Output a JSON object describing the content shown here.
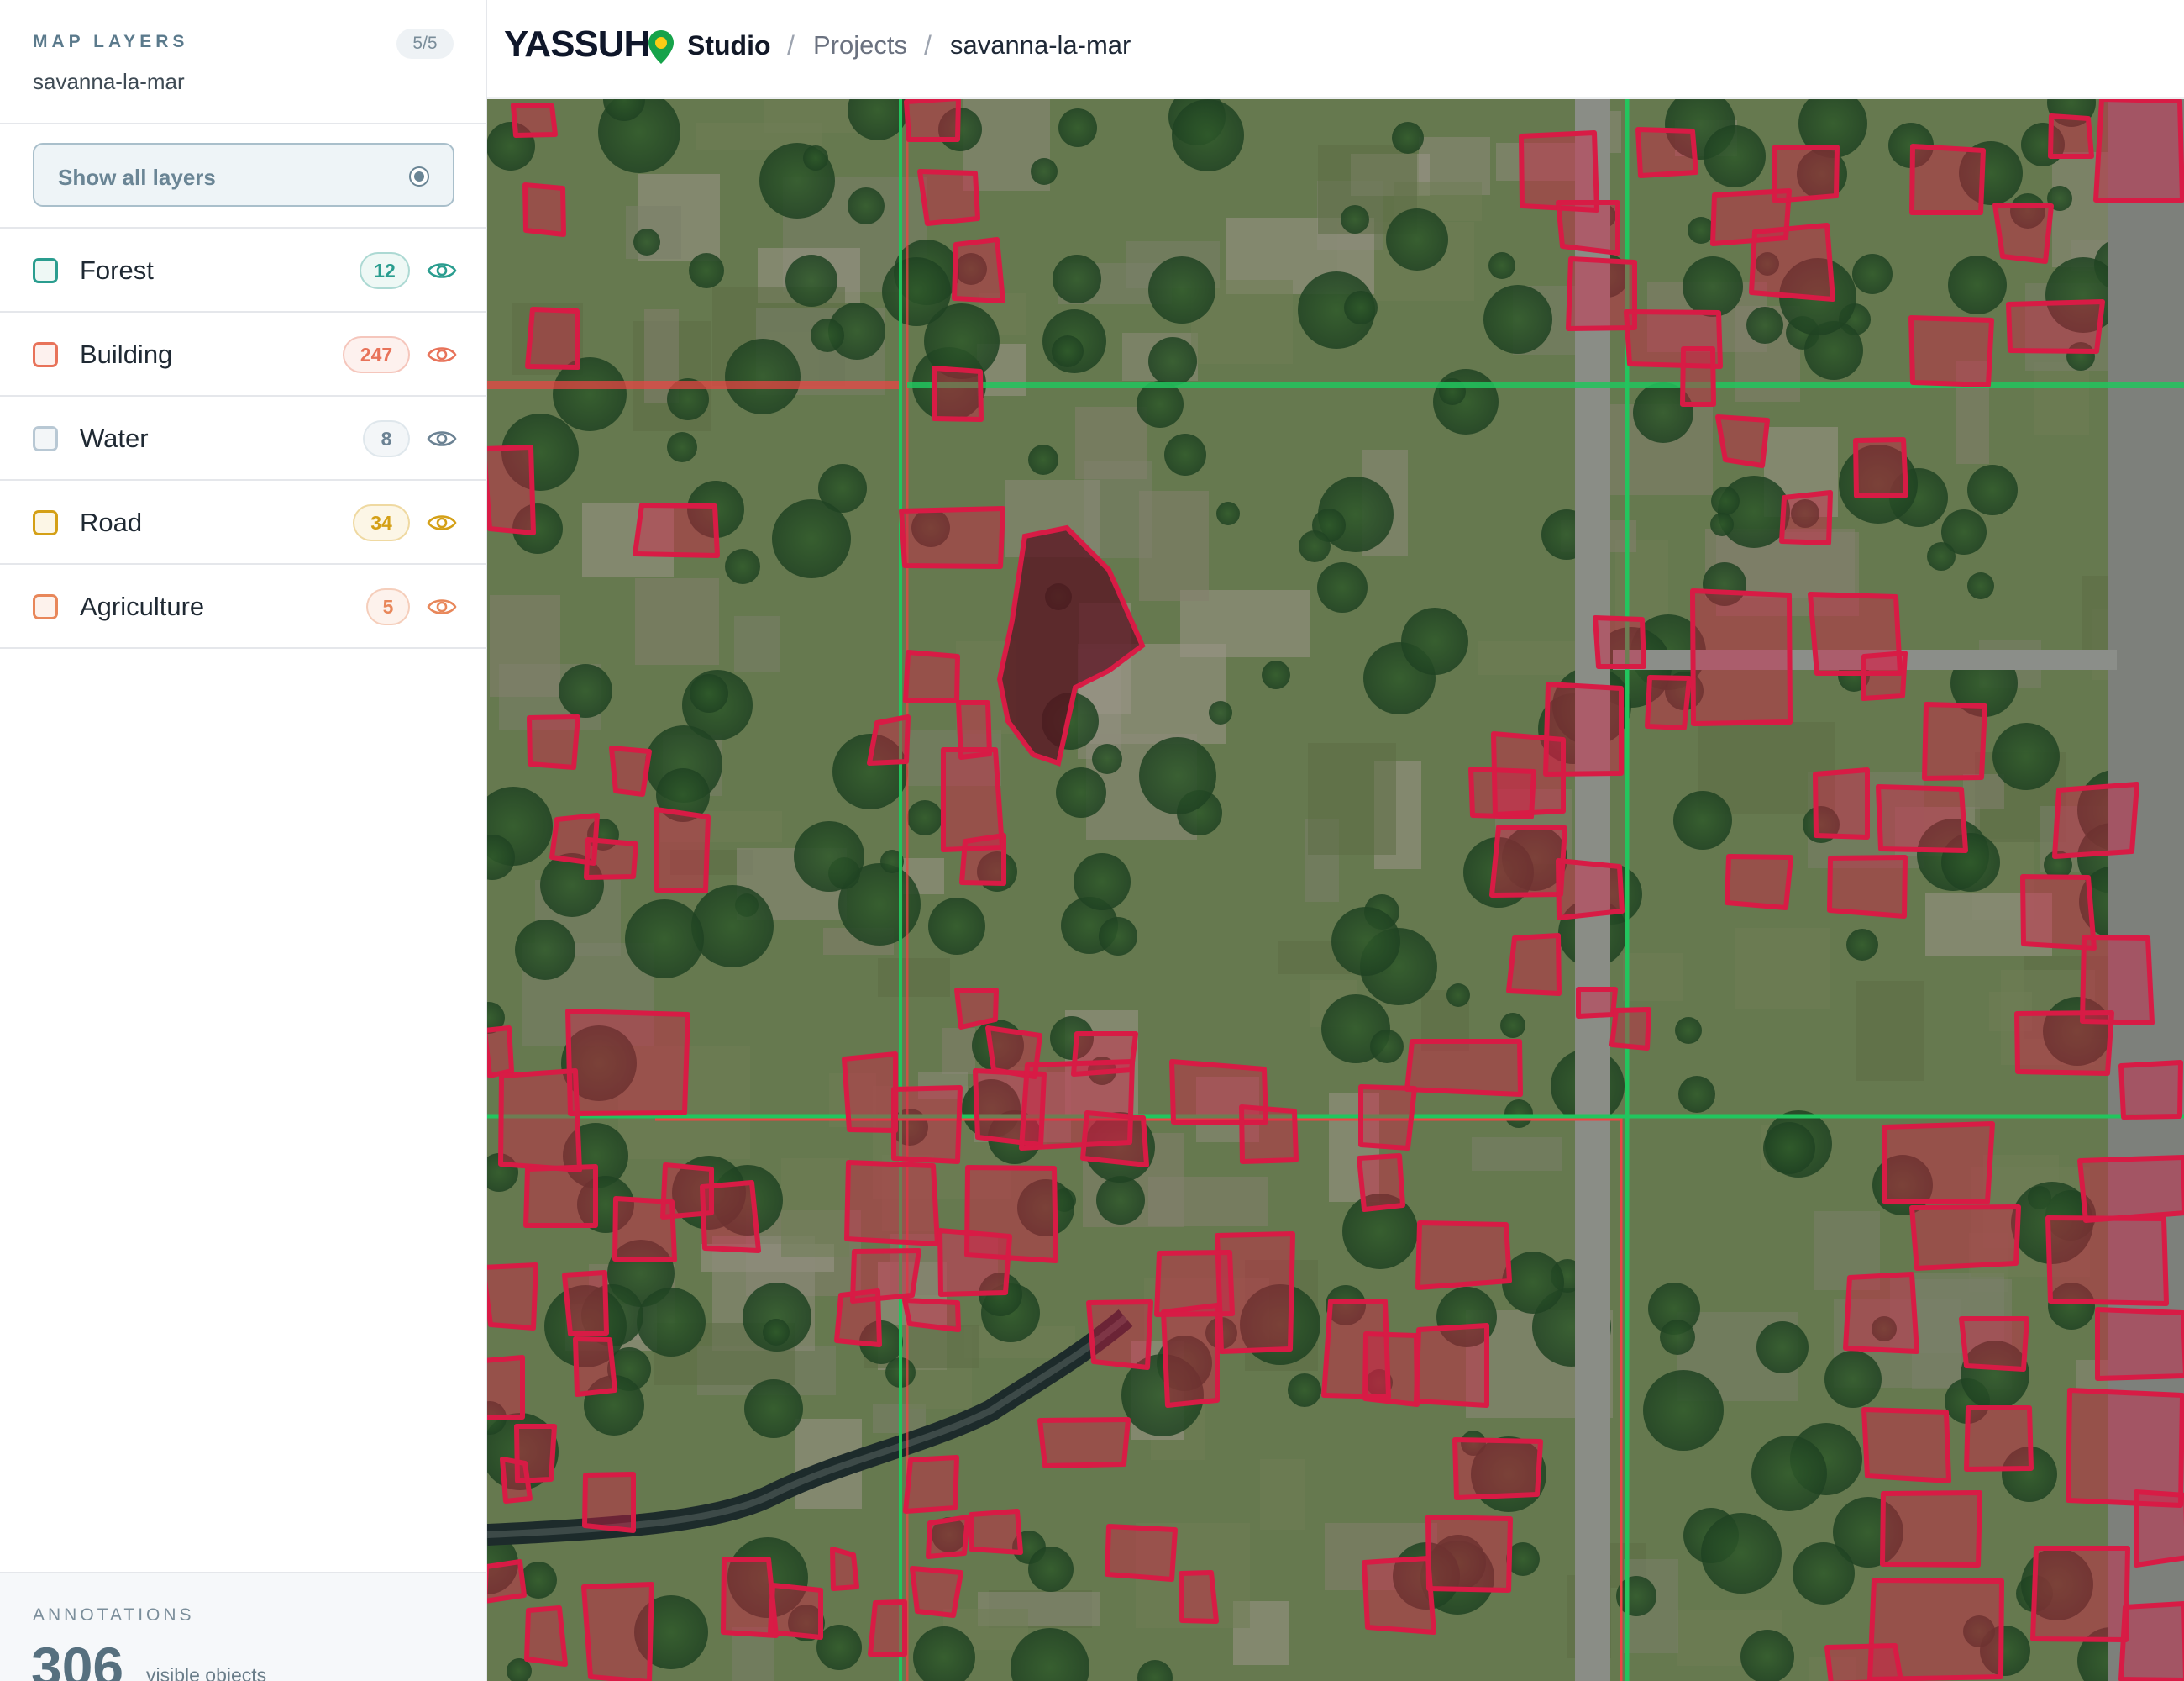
{
  "sidebar": {
    "title": "MAP LAYERS",
    "visible_count": "5/5",
    "project_name": "savanna-la-mar",
    "show_all_label": "Show all layers",
    "layers": [
      {
        "name": "Forest",
        "count": "12",
        "color": "#2a9d8f",
        "badge_bg": "#eef8f5",
        "visible": true,
        "icon": "eye-icon"
      },
      {
        "name": "Building",
        "count": "247",
        "color": "#e8735a",
        "badge_bg": "#fdf1ee",
        "visible": true,
        "icon": "eye-icon"
      },
      {
        "name": "Water",
        "count": "8",
        "color": "#b8c8d4",
        "badge_bg": "#f3f6f8",
        "visible": true,
        "icon": "eye-icon"
      },
      {
        "name": "Road",
        "count": "34",
        "color": "#d4a017",
        "badge_bg": "#fcf6e6",
        "visible": true,
        "icon": "eye-icon"
      },
      {
        "name": "Agriculture",
        "count": "5",
        "color": "#e8875a",
        "badge_bg": "#fdf2ec",
        "visible": true,
        "icon": "eye-icon"
      }
    ]
  },
  "footer": {
    "label": "ANNOTATIONS",
    "total": "306",
    "caption": "visible objects"
  },
  "header": {
    "brand": "YASSUH",
    "product": "Studio",
    "breadcrumb": [
      "Projects",
      "savanna-la-mar"
    ],
    "separator": "/"
  },
  "map": {
    "building_color": "#d81b45",
    "road_line_color": "#22c55e",
    "road_line_alt_color": "#ef4444"
  }
}
